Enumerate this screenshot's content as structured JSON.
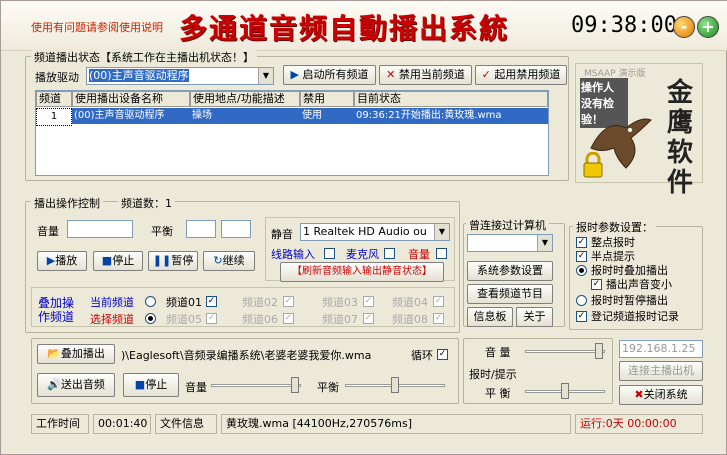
{
  "header": {
    "help_link": "使用有问题请参阅使用说明",
    "title": "多通道音频自動播出系統",
    "clock": "09:38:00",
    "minus_icon": "-",
    "plus_icon": "+"
  },
  "channel_status": {
    "group_title": "频道播出状态【系统工作在主播出机状态！】",
    "driver_label": "播放驱动",
    "driver_value": "(00)主声音驱动程序",
    "btn_start_all": "启动所有频道",
    "btn_disable_current": "禁用当前频道",
    "btn_enable_disabled": "起用禁用频道",
    "columns": [
      "频道",
      "使用播出设备名称",
      "使用地点/功能描述",
      "禁用",
      "目前状态"
    ],
    "rows": [
      {
        "channel": "1",
        "device": "(00)主声音驱动程序",
        "location": "操场",
        "disabled": "使用",
        "status": "09:36:21开始播出:黄玫瑰.wma"
      }
    ]
  },
  "logo": {
    "version_label": "MSAAP  演示版",
    "operator_text_1": "操作人员：",
    "operator_text_2": "没有检验！",
    "brand": "金鹰软件"
  },
  "playback": {
    "group_title": "播出操作控制",
    "channel_count": "频道数：1",
    "volume_label": "音量",
    "balance_label": "平衡",
    "btn_play": "播放",
    "btn_stop": "停止",
    "btn_pause": "暂停",
    "btn_continue": "继续",
    "mute_label": "静音",
    "device_value": "1 Realtek HD Audio ou",
    "line_in_label": "线路输入",
    "mic_label": "麦克风",
    "volume_short": "音量",
    "refresh_btn": "【刷新音频输入输出静音状态】",
    "mix_label_1": "叠加操",
    "mix_label_2": "作频道",
    "current_channel_label": "当前频道",
    "select_channel_label": "选择频道",
    "channels_row1": [
      "频道01",
      "频道02",
      "频道03",
      "频道04"
    ],
    "channels_row2": [
      "频道05",
      "频道06",
      "频道07",
      "频道08"
    ]
  },
  "computer": {
    "group_title": "曾连接过计算机",
    "combo_value": "",
    "btn_params": "系统参数设置",
    "btn_programs": "查看频道节目",
    "btn_info": "信息板",
    "btn_about": "关于"
  },
  "time_report": {
    "group_title": "报时参数设置：",
    "opt_hourly": "整点报时",
    "opt_half": "半点提示",
    "opt_overlay": "报时时叠加播出",
    "opt_lower": "播出声音变小",
    "opt_pause": "报时时暂停播出",
    "opt_log": "登记频道报时记录"
  },
  "overlay": {
    "btn_overlay_play": "叠加播出",
    "file_path": ")\\Eaglesoft\\音频录编播系统\\老婆老婆我爱你.wma",
    "loop_label": "循环",
    "btn_send_audio": "送出音频",
    "btn_stop": "停止",
    "volume_label": "音量",
    "balance_label": "平衡",
    "right_volume_label": "音 量",
    "report_label": "报时/提示",
    "right_balance_label": "平 衡"
  },
  "connect": {
    "ip_value": "192.168.1.25",
    "btn_connect": "连接主播出机",
    "btn_close": "关闭系统"
  },
  "statusbar": {
    "work_time_label": "工作时间",
    "work_time_value": "00:01:40",
    "file_info_label": "文件信息",
    "file_info_value": "黄玫瑰.wma [44100Hz,270576ms]",
    "running_label": "运行:0天 00:00:00"
  }
}
